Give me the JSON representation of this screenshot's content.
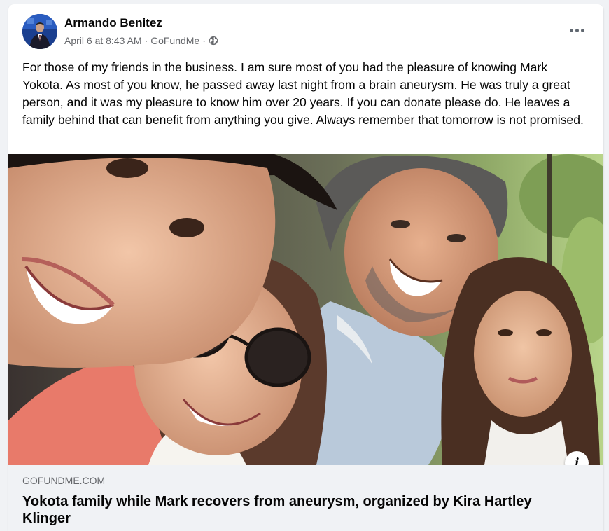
{
  "post": {
    "author": "Armando Benitez",
    "date": "April 6 at 8:43 AM",
    "separator": "·",
    "source": "GoFundMe",
    "audience_icon": "globe-icon",
    "menu_icon": "more-options-icon",
    "text": "For those of my friends in the business. I am sure most of you had the pleasure of knowing Mark Yokota. As most of you know, he passed away last night from a brain aneurysm. He was truly a great person, and it was my pleasure to know him over 20 years. If you can donate please do. He leaves a family behind that can benefit from anything you give. Always remember that tomorrow is not promised."
  },
  "link": {
    "domain": "GOFUNDME.COM",
    "title": "Yokota family while Mark recovers from aneurysm, organized by Kira Hartley Klinger",
    "info_icon": "info-icon",
    "info_glyph": "i"
  },
  "colors": {
    "page_bg": "#f0f2f5",
    "card_bg": "#ffffff",
    "primary_text": "#050505",
    "secondary_text": "#65676b"
  }
}
